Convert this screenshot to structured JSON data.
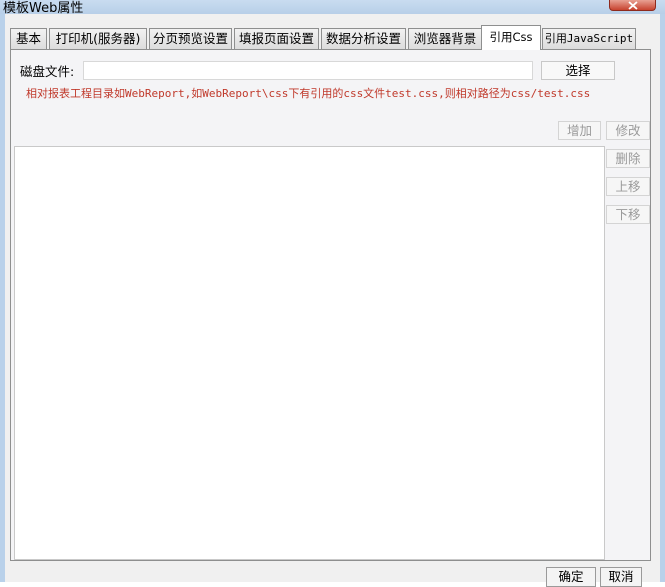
{
  "window": {
    "title": "模板Web属性"
  },
  "tabs": [
    {
      "label": "基本"
    },
    {
      "label": "打印机(服务器)"
    },
    {
      "label": "分页预览设置"
    },
    {
      "label": "填报页面设置"
    },
    {
      "label": "数据分析设置"
    },
    {
      "label": "浏览器背景"
    },
    {
      "label": "引用Css",
      "active": true
    },
    {
      "label": "引用JavaScript"
    }
  ],
  "css_panel": {
    "disk_file_label": "磁盘文件:",
    "disk_file_value": "",
    "select_button": "选择",
    "hint": "相对报表工程目录如WebReport,如WebReport\\css下有引用的css文件test.css,则相对路径为css/test.css",
    "add_button": "增加",
    "modify_button": "修改",
    "delete_button": "删除",
    "move_up_button": "上移",
    "move_down_button": "下移"
  },
  "footer": {
    "ok_button": "确定",
    "cancel_button": "取消"
  }
}
